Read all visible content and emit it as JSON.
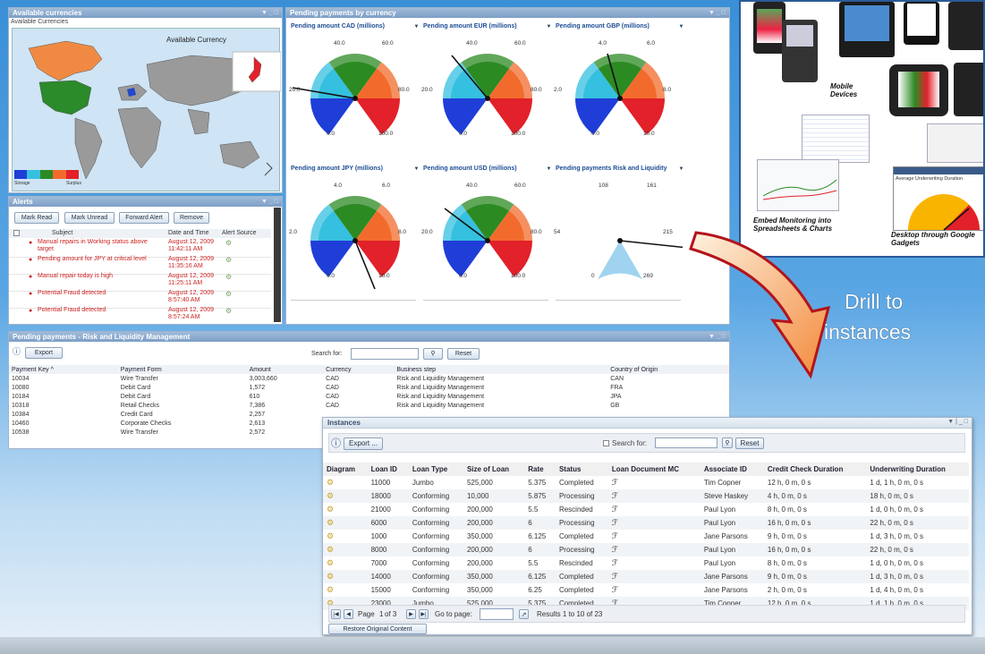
{
  "currencies": {
    "title": "Available currencies",
    "subtitle": "Available Currencies",
    "map_label": "Available Currency",
    "legend_low": "Storage",
    "legend_high": "Surplus"
  },
  "pending": {
    "title": "Pending payments by currency",
    "gauges": [
      {
        "title": "Pending amount CAD (millions)",
        "labels": [
          "40.0",
          "60.0",
          "20.0",
          "80.0",
          "0.0",
          "100.0"
        ]
      },
      {
        "title": "Pending amount EUR (millions)",
        "labels": [
          "40.0",
          "60.0",
          "20.0",
          "80.0",
          "0.0",
          "100.0"
        ]
      },
      {
        "title": "Pending amount GBP (millions)",
        "labels": [
          "4.0",
          "6.0",
          "2.0",
          "8.0",
          "0.0",
          "10.0"
        ]
      },
      {
        "title": "Pending amount JPY (millions)",
        "labels": [
          "4.0",
          "6.0",
          "2.0",
          "8.0",
          "0.0",
          "10.0"
        ]
      },
      {
        "title": "Pending amount USD (millions)",
        "labels": [
          "40.0",
          "60.0",
          "20.0",
          "80.0",
          "0.0",
          "100.0"
        ]
      },
      {
        "title": "Pending payments Risk and Liquidity",
        "labels": [
          "108",
          "161",
          "54",
          "215",
          "0",
          "269"
        ]
      }
    ]
  },
  "alerts": {
    "title": "Alerts",
    "buttons": [
      "Mark Read",
      "Mark Unread",
      "Forward Alert",
      "Remove"
    ],
    "columns": [
      "Subject",
      "Date and Time",
      "Alert Source"
    ],
    "rows": [
      {
        "subject": "Manual repairs in Working status above target",
        "date": "August 12, 2009",
        "time": "11:42:11 AM"
      },
      {
        "subject": "Pending amount for JPY at critical level",
        "date": "August 12, 2009",
        "time": "11:35:16 AM"
      },
      {
        "subject": "Manual repair today is high",
        "date": "August 12, 2009",
        "time": "11:25:11 AM"
      },
      {
        "subject": "Potential Fraud detected",
        "date": "August 12, 2009",
        "time": "8:57:40 AM"
      },
      {
        "subject": "Potential Fraud detected",
        "date": "August 12, 2009",
        "time": "8:57:24 AM"
      }
    ]
  },
  "payments": {
    "title": "Pending payments - Risk and Liquidity Management",
    "export": "Export",
    "search_label": "Search for:",
    "reset": "Reset",
    "columns": [
      "Payment Key ^",
      "Payment Form",
      "Amount",
      "Currency",
      "Business step",
      "Country of Origin"
    ],
    "rows": [
      [
        "10034",
        "Wire Transfer",
        "3,003,660",
        "CAD",
        "Risk and Liquidity Management",
        "CAN"
      ],
      [
        "10080",
        "Debit Card",
        "1,572",
        "CAD",
        "Risk and Liquidity Management",
        "FRA"
      ],
      [
        "10184",
        "Debit Card",
        "610",
        "CAD",
        "Risk and Liquidity Management",
        "JPA"
      ],
      [
        "10318",
        "Retail Checks",
        "7,386",
        "CAD",
        "Risk and Liquidity Management",
        "GB"
      ],
      [
        "10384",
        "Credit Card",
        "2,257",
        "",
        "",
        ""
      ],
      [
        "10460",
        "Corporate Checks",
        "2,613",
        "",
        "",
        ""
      ],
      [
        "10538",
        "Wire Transfer",
        "2,572",
        "",
        "",
        ""
      ]
    ]
  },
  "promo": {
    "mobile": "Mobile Devices",
    "embed": "Embed Monitoring into Spreadsheets & Charts",
    "desktop": "Desktop through Google Gadgets",
    "desktop_sub": "Average Underwriting Duration"
  },
  "drill": {
    "line1": "Drill to",
    "line2": "instances"
  },
  "instances": {
    "title": "Instances",
    "export": "Export ...",
    "search_label": "Search for:",
    "reset": "Reset",
    "columns": [
      "Diagram",
      "Loan ID",
      "Loan Type",
      "Size of Loan",
      "Rate",
      "Status",
      "Loan Document MC",
      "Associate ID",
      "Credit Check Duration",
      "Underwriting Duration"
    ],
    "rows": [
      [
        "11000",
        "Jumbo",
        "525,000",
        "5.375",
        "Completed",
        "Tim Copner",
        "12 h, 0 m, 0 s",
        "1 d, 1 h, 0 m, 0 s"
      ],
      [
        "18000",
        "Conforming",
        "10,000",
        "5.875",
        "Processing",
        "Steve Haskey",
        "4 h, 0 m, 0 s",
        "18 h, 0 m, 0 s"
      ],
      [
        "21000",
        "Conforming",
        "200,000",
        "5.5",
        "Rescinded",
        "Paul Lyon",
        "8 h, 0 m, 0 s",
        "1 d, 0 h, 0 m, 0 s"
      ],
      [
        "6000",
        "Conforming",
        "200,000",
        "6",
        "Processing",
        "Paul Lyon",
        "16 h, 0 m, 0 s",
        "22 h, 0 m, 0 s"
      ],
      [
        "1000",
        "Conforming",
        "350,000",
        "6.125",
        "Completed",
        "Jane Parsons",
        "9 h, 0 m, 0 s",
        "1 d, 3 h, 0 m, 0 s"
      ],
      [
        "8000",
        "Conforming",
        "200,000",
        "6",
        "Processing",
        "Paul Lyon",
        "16 h, 0 m, 0 s",
        "22 h, 0 m, 0 s"
      ],
      [
        "7000",
        "Conforming",
        "200,000",
        "5.5",
        "Rescinded",
        "Paul Lyon",
        "8 h, 0 m, 0 s",
        "1 d, 0 h, 0 m, 0 s"
      ],
      [
        "14000",
        "Conforming",
        "350,000",
        "6.125",
        "Completed",
        "Jane Parsons",
        "9 h, 0 m, 0 s",
        "1 d, 3 h, 0 m, 0 s"
      ],
      [
        "15000",
        "Conforming",
        "350,000",
        "6.25",
        "Completed",
        "Jane Parsons",
        "2 h, 0 m, 0 s",
        "1 d, 4 h, 0 m, 0 s"
      ],
      [
        "23000",
        "Jumbo",
        "525,000",
        "5.375",
        "Completed",
        "Tim Copner",
        "12 h, 0 m, 0 s",
        "1 d, 1 h, 0 m, 0 s"
      ]
    ],
    "pager": {
      "page_prefix": "Page",
      "page_num": "1",
      "page_of": "of 3",
      "goto": "Go to page:",
      "results": "Results 1 to 10 of 23"
    },
    "restore": "Restore Original Content"
  },
  "colors": {
    "green": "#2c8a23",
    "cyan": "#35c0e0",
    "blue": "#1f3ed8",
    "orange": "#f26b2c",
    "red": "#e2212a",
    "accent": "#1d4d94"
  },
  "icons": [
    "diagram-icon",
    "alert-source-icon",
    "document-icon",
    "search-icon",
    "pager-first-icon",
    "pager-prev-icon",
    "pager-next-icon",
    "pager-last-icon",
    "go-icon"
  ]
}
